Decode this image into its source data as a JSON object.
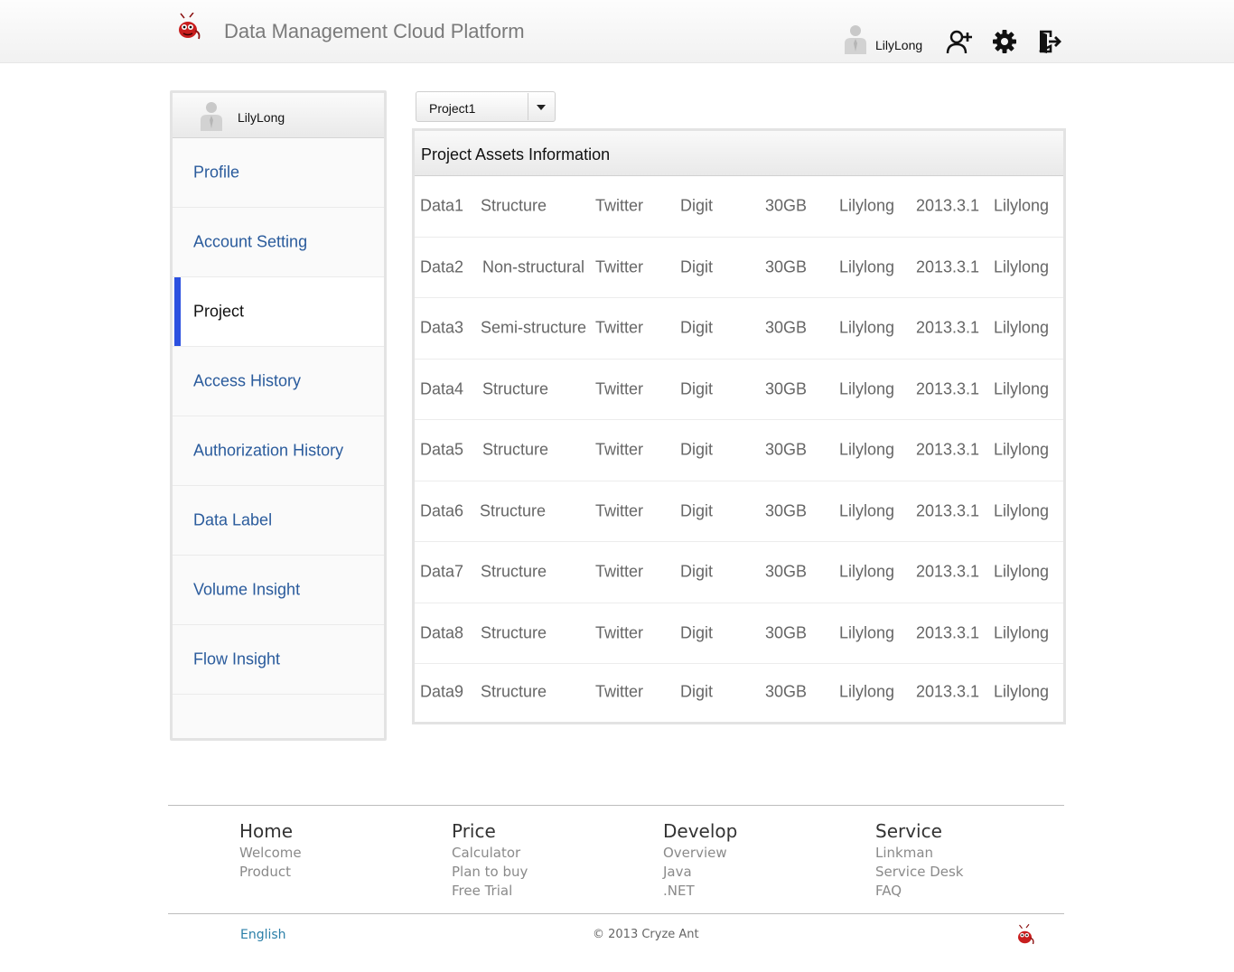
{
  "header": {
    "title": "Data Management Cloud Platform",
    "username": "LilyLong",
    "icons": [
      "logo-ant-icon",
      "user-avatar-icon",
      "add-user-icon",
      "gear-icon",
      "logout-icon"
    ]
  },
  "sidebar": {
    "username": "LilyLong",
    "items": [
      {
        "label": "Profile",
        "active": false
      },
      {
        "label": "Account Setting",
        "active": false
      },
      {
        "label": "Project",
        "active": true
      },
      {
        "label": "Access History",
        "active": false
      },
      {
        "label": "Authorization History",
        "active": false
      },
      {
        "label": "Data Label",
        "active": false
      },
      {
        "label": "Volume Insight",
        "active": false
      },
      {
        "label": "Flow Insight",
        "active": false
      }
    ],
    "active_color": "#2b50e0"
  },
  "project_select": {
    "value": "Project1"
  },
  "assets": {
    "title": "Project Assets Information",
    "rows": [
      [
        "Data1",
        "Structure",
        "Twitter",
        "Digit",
        "30GB",
        "Lilylong",
        "2013.3.1",
        "Lilylong"
      ],
      [
        "Data2",
        "Non-structural",
        "Twitter",
        "Digit",
        "30GB",
        "Lilylong",
        "2013.3.1",
        "Lilylong"
      ],
      [
        "Data3",
        "Semi-structure",
        "Twitter",
        "Digit",
        "30GB",
        "Lilylong",
        "2013.3.1",
        "Lilylong"
      ],
      [
        "Data4",
        "Structure",
        "Twitter",
        "Digit",
        "30GB",
        "Lilylong",
        "2013.3.1",
        "Lilylong"
      ],
      [
        "Data5",
        "Structure",
        "Twitter",
        "Digit",
        "30GB",
        "Lilylong",
        "2013.3.1",
        "Lilylong"
      ],
      [
        "Data6",
        "Structure",
        "Twitter",
        "Digit",
        "30GB",
        "Lilylong",
        "2013.3.1",
        "Lilylong"
      ],
      [
        "Data7",
        "Structure",
        "Twitter",
        "Digit",
        "30GB",
        "Lilylong",
        "2013.3.1",
        "Lilylong"
      ],
      [
        "Data8",
        "Structure",
        "Twitter",
        "Digit",
        "30GB",
        "Lilylong",
        "2013.3.1",
        "Lilylong"
      ],
      [
        "Data9",
        "Structure",
        "Twitter",
        "Digit",
        "30GB",
        "Lilylong",
        "2013.3.1",
        "Lilylong"
      ]
    ]
  },
  "footer": {
    "columns": [
      {
        "heading": "Home",
        "links": [
          "Welcome",
          "Product"
        ]
      },
      {
        "heading": "Price",
        "links": [
          "Calculator",
          "Plan to buy",
          "Free Trial"
        ]
      },
      {
        "heading": "Develop",
        "links": [
          "Overview",
          "Java",
          ".NET"
        ]
      },
      {
        "heading": "Service",
        "links": [
          "Linkman",
          "Service Desk",
          "FAQ"
        ]
      }
    ],
    "language": "English",
    "copyright": "© 2013 Cryze Ant"
  }
}
